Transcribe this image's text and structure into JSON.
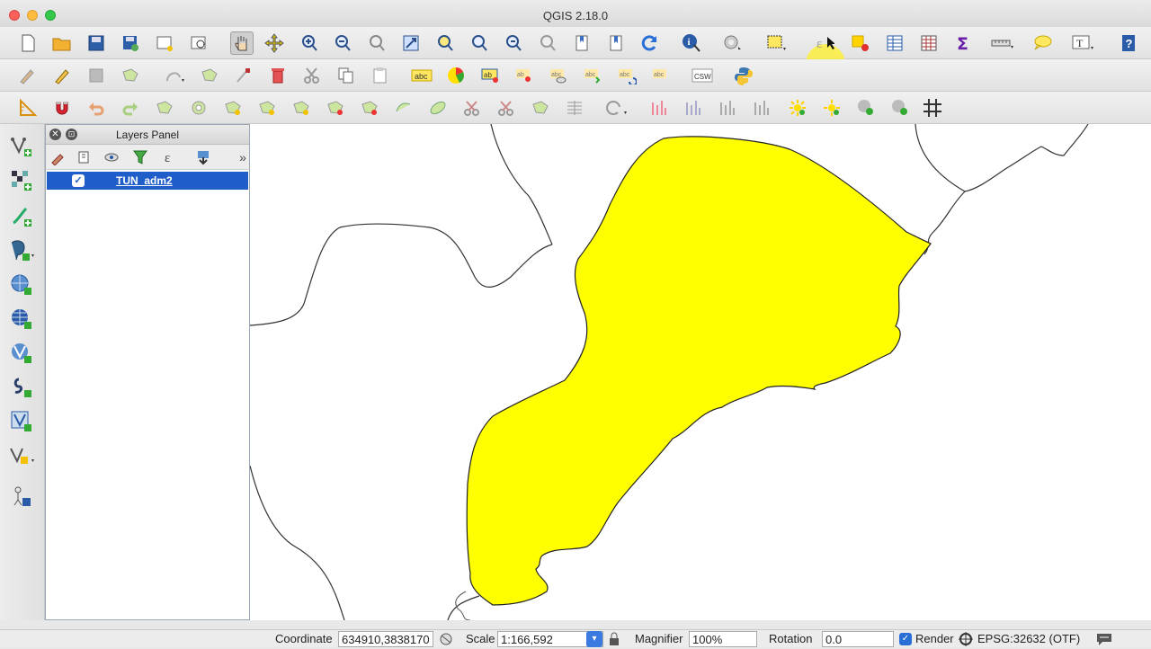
{
  "window": {
    "title": "QGIS 2.18.0"
  },
  "layers_panel": {
    "title": "Layers Panel",
    "layers": [
      {
        "name": "TUN_adm2",
        "checked": true
      }
    ]
  },
  "status": {
    "coordinate_label": "Coordinate",
    "coordinate_value": "634910,3838170",
    "scale_label": "Scale",
    "scale_value": "1:166,592",
    "magnifier_label": "Magnifier",
    "magnifier_value": "100%",
    "rotation_label": "Rotation",
    "rotation_value": "0.0",
    "render_label": "Render",
    "crs_label": "EPSG:32632 (OTF)"
  },
  "colors": {
    "selected_polygon": "#ffff00",
    "selection_row": "#1f5ec9"
  },
  "toolbar_buttons": {
    "csw": "CSW",
    "abc": "abc"
  }
}
